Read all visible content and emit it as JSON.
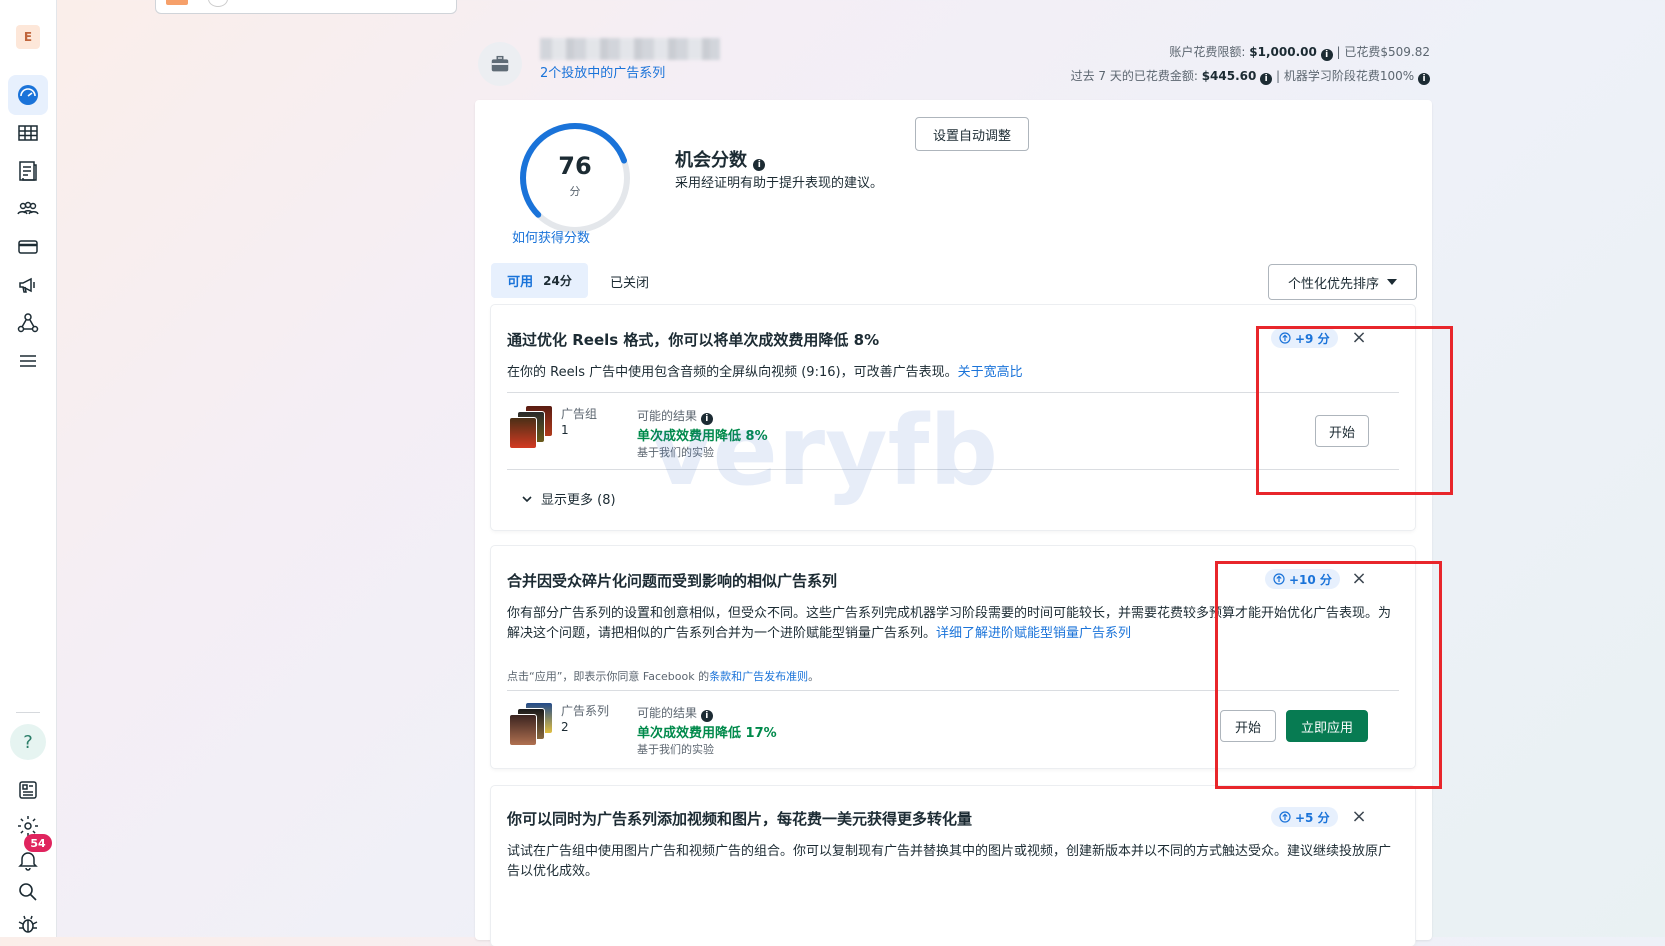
{
  "nav": {
    "account_initial": "E",
    "help_label": "?",
    "notifications_count": "54"
  },
  "header": {
    "campaign_link": "2个投放中的广告系列",
    "spend_limit_label": "账户花费限额: ",
    "spend_limit_value": "$1,000.00",
    "spent_label": "| 已花费$509.82",
    "last7_label": "过去 7 天的已花费金额: ",
    "last7_value": "$445.60",
    "learning_label": "| 机器学习阶段花费100%"
  },
  "opportunity": {
    "score": "76",
    "score_unit": "分",
    "score_fraction": 0.76,
    "how_link": "如何获得分数",
    "title": "机会分数",
    "subtitle": "采用经证明有助于提升表现的建议。",
    "auto_adjust_button": "设置自动调整"
  },
  "tabs": {
    "available_label": "可用",
    "available_count": "24分",
    "closed_label": "已关闭",
    "sort_label": "个性化优先排序"
  },
  "cards": [
    {
      "title": "通过优化 Reels 格式，你可以将单次成效费用降低 8%",
      "points": "+9 分",
      "description": "在你的 Reels 广告中使用包含音频的全屏纵向视频 (9:16)，可改善广告表现。",
      "description_link": "关于宽高比",
      "meta_key": "广告组",
      "meta_value": "1",
      "result_label": "可能的结果",
      "result_value": "单次成效费用降低 8%",
      "result_note": "基于我们的实验",
      "start_button": "开始",
      "show_more": "显示更多 (8)"
    },
    {
      "title": "合并因受众碎片化问题而受到影响的相似广告系列",
      "points": "+10 分",
      "description": "你有部分广告系列的设置和创意相似，但受众不同。这些广告系列完成机器学习阶段需要的时间可能较长，并需要花费较多预算才能开始优化广告表现。为解决这个问题，请把相似的广告系列合并为一个进阶赋能型销量广告系列。",
      "description_link": "详细了解进阶赋能型销量广告系列",
      "terms_prefix": "点击“应用”，即表示你同意 Facebook 的",
      "terms_link": "条款和广告发布准则",
      "terms_suffix": "。",
      "meta_key": "广告系列",
      "meta_value": "2",
      "result_label": "可能的结果",
      "result_value": "单次成效费用降低 17%",
      "result_note": "基于我们的实验",
      "start_button": "开始",
      "apply_button": "立即应用"
    },
    {
      "title": "你可以同时为广告系列添加视频和图片，每花费一美元获得更多转化量",
      "points": "+5 分",
      "description": "试试在广告组中使用图片广告和视频广告的组合。你可以复制现有广告并替换其中的图片或视频，创建新版本并以不同的方式触达受众。建议继续投放原广告以优化成效。"
    }
  ],
  "watermark": "veryfb",
  "colors": {
    "accent": "#1a73d9",
    "apply_green": "#077b52",
    "result_green": "#008a4b",
    "annotation_red": "#e8262b"
  },
  "icons": [
    "dashboard-icon",
    "table-icon",
    "catalog-icon",
    "audience-icon",
    "billing-icon",
    "megaphone-icon",
    "network-icon",
    "menu-icon",
    "help-icon",
    "news-icon",
    "gear-icon",
    "bell-icon",
    "search-icon",
    "bug-icon",
    "briefcase-icon",
    "close-icon",
    "chevron-down-icon"
  ]
}
